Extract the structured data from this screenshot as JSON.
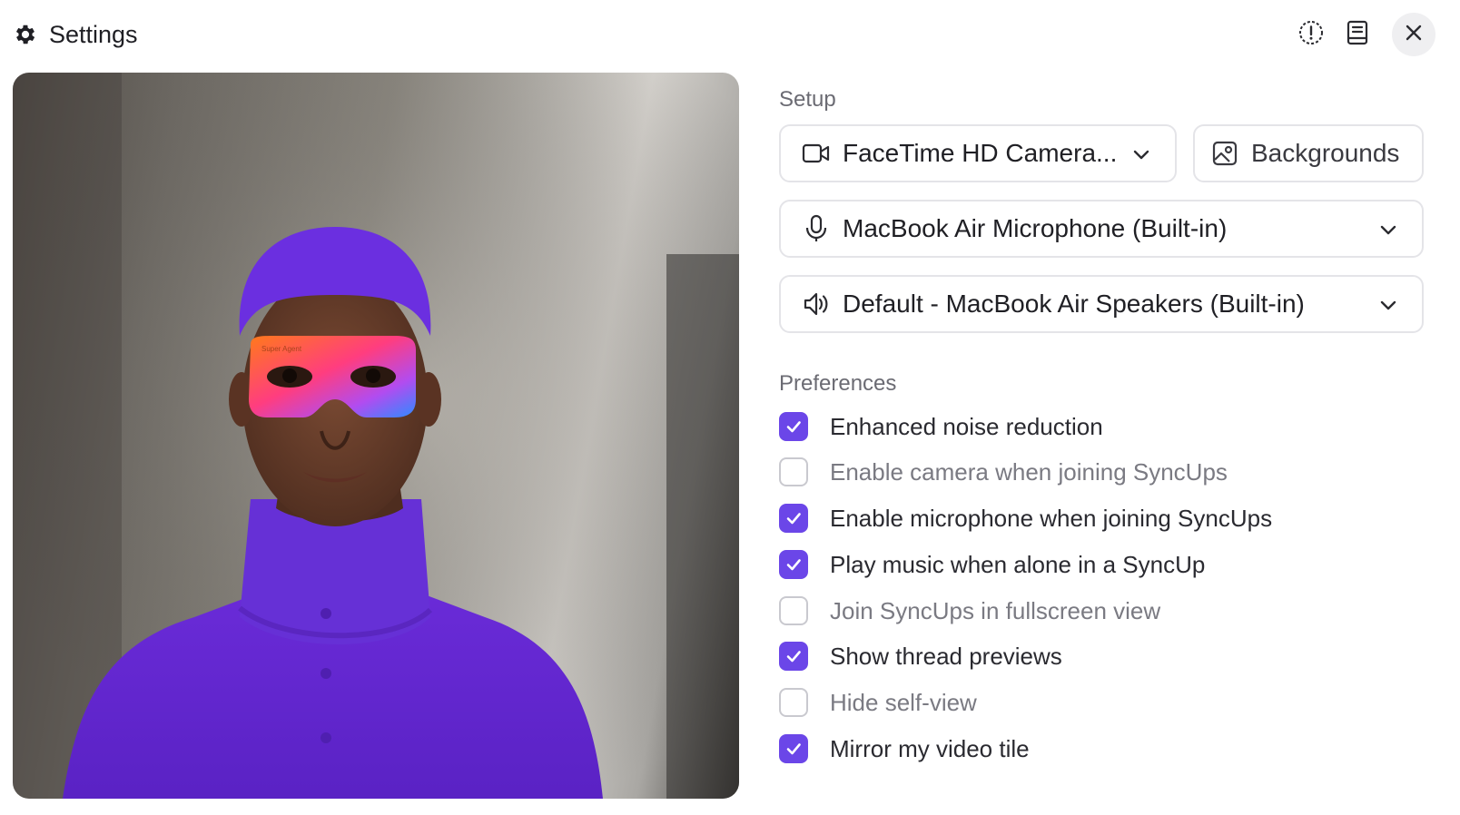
{
  "window": {
    "title": "Settings",
    "title_icon": "gear-icon",
    "actions": [
      {
        "name": "feedback-button",
        "icon": "alert-circle-icon"
      },
      {
        "name": "docs-button",
        "icon": "book-icon"
      },
      {
        "name": "close-button",
        "icon": "close-icon"
      }
    ]
  },
  "preview": {
    "mask_brand": "Super Agent"
  },
  "setup": {
    "label": "Setup",
    "camera": {
      "value": "FaceTime HD Camera...",
      "icon": "video-camera-icon"
    },
    "backgrounds": {
      "label": "Backgrounds",
      "icon": "image-icon"
    },
    "microphone": {
      "value": "MacBook Air Microphone (Built-in)",
      "icon": "microphone-icon"
    },
    "speaker": {
      "value": "Default - MacBook Air Speakers (Built-in)",
      "icon": "speaker-icon"
    }
  },
  "preferences": {
    "label": "Preferences",
    "items": [
      {
        "label": "Enhanced noise reduction",
        "checked": true
      },
      {
        "label": "Enable camera when joining SyncUps",
        "checked": false
      },
      {
        "label": "Enable microphone when joining SyncUps",
        "checked": true
      },
      {
        "label": "Play music when alone in a SyncUp",
        "checked": true
      },
      {
        "label": "Join SyncUps in fullscreen view",
        "checked": false
      },
      {
        "label": "Show thread previews",
        "checked": true
      },
      {
        "label": "Hide self-view",
        "checked": false
      },
      {
        "label": "Mirror my video tile",
        "checked": true
      }
    ]
  },
  "colors": {
    "accent": "#6b46e8",
    "muted_text": "#6b6b73",
    "border": "#e4e4e8"
  }
}
